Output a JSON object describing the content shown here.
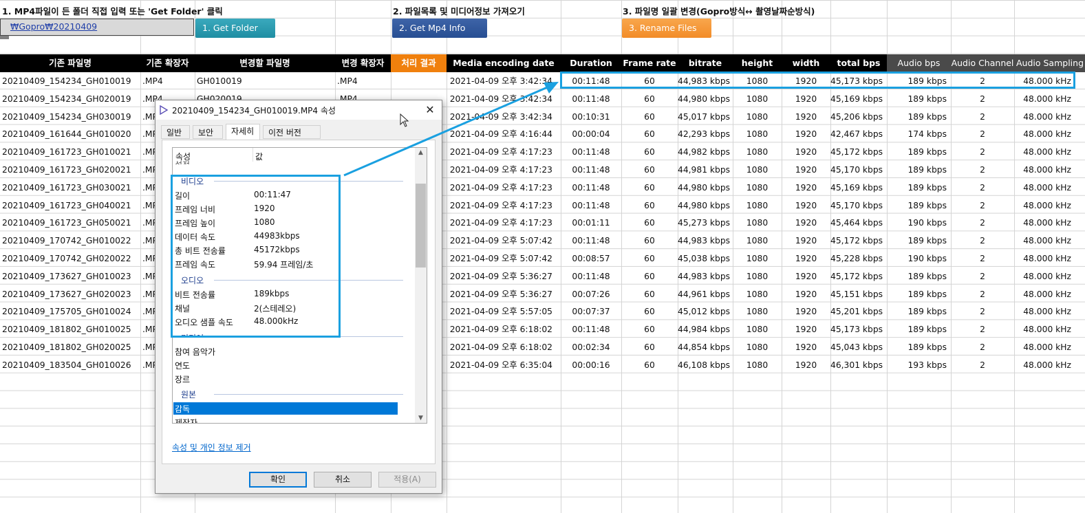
{
  "steps": {
    "step1": "1. MP4파일이 든 폴더 직접 입력 또는 'Get Folder' 클릭",
    "step2": "2. 파일목록 및 미디어정보 가져오기",
    "step3": "3. 파일명 일괄 변경(Gopro방식↔ 촬영날짜순방식)"
  },
  "folder_path": "₩Gopro₩20210409",
  "buttons": {
    "get_folder": "1. Get Folder",
    "get_mp4_info": "2. Get Mp4 Info",
    "rename_files": "3. Rename Files"
  },
  "headers": [
    "기존 파일명",
    "기존 확장자",
    "변경할 파일명",
    "변경 확장자",
    "처리 결과",
    "Media encoding date",
    "Duration",
    "Frame rate",
    "bitrate",
    "height",
    "width",
    "total bps",
    "Audio bps",
    "Audio Channel",
    "Audio Sampling"
  ],
  "rows": [
    [
      "20210409_154234_GH010019",
      ".MP4",
      "GH010019",
      ".MP4",
      "",
      "2021-04-09 오후 3:42:34",
      "00:11:48",
      "60",
      "44,983 kbps",
      "1080",
      "1920",
      "45,173 kbps",
      "189 kbps",
      "2",
      "48.000 kHz"
    ],
    [
      "20210409_154234_GH020019",
      ".MP4",
      "GH020019",
      ".MP4",
      "",
      "2021-04-09 오후 3:42:34",
      "00:11:48",
      "60",
      "44,980 kbps",
      "1080",
      "1920",
      "45,169 kbps",
      "189 kbps",
      "2",
      "48.000 kHz"
    ],
    [
      "20210409_154234_GH030019",
      ".MP4",
      "",
      "",
      "",
      "2021-04-09 오후 3:42:34",
      "00:10:31",
      "60",
      "45,017 kbps",
      "1080",
      "1920",
      "45,206 kbps",
      "189 kbps",
      "2",
      "48.000 kHz"
    ],
    [
      "20210409_161644_GH010020",
      ".MP4",
      "",
      "",
      "",
      "2021-04-09 오후 4:16:44",
      "00:00:04",
      "60",
      "42,293 kbps",
      "1080",
      "1920",
      "42,467 kbps",
      "174 kbps",
      "2",
      "48.000 kHz"
    ],
    [
      "20210409_161723_GH010021",
      ".MP4",
      "",
      "",
      "",
      "2021-04-09 오후 4:17:23",
      "00:11:48",
      "60",
      "44,982 kbps",
      "1080",
      "1920",
      "45,172 kbps",
      "189 kbps",
      "2",
      "48.000 kHz"
    ],
    [
      "20210409_161723_GH020021",
      ".MP4",
      "",
      "",
      "",
      "2021-04-09 오후 4:17:23",
      "00:11:48",
      "60",
      "44,981 kbps",
      "1080",
      "1920",
      "45,170 kbps",
      "189 kbps",
      "2",
      "48.000 kHz"
    ],
    [
      "20210409_161723_GH030021",
      ".MP4",
      "",
      "",
      "",
      "2021-04-09 오후 4:17:23",
      "00:11:48",
      "60",
      "44,980 kbps",
      "1080",
      "1920",
      "45,169 kbps",
      "189 kbps",
      "2",
      "48.000 kHz"
    ],
    [
      "20210409_161723_GH040021",
      ".MP4",
      "",
      "",
      "",
      "2021-04-09 오후 4:17:23",
      "00:11:48",
      "60",
      "44,980 kbps",
      "1080",
      "1920",
      "45,170 kbps",
      "189 kbps",
      "2",
      "48.000 kHz"
    ],
    [
      "20210409_161723_GH050021",
      ".MP4",
      "",
      "",
      "",
      "2021-04-09 오후 4:17:23",
      "00:01:11",
      "60",
      "45,273 kbps",
      "1080",
      "1920",
      "45,464 kbps",
      "190 kbps",
      "2",
      "48.000 kHz"
    ],
    [
      "20210409_170742_GH010022",
      ".MP4",
      "",
      "",
      "",
      "2021-04-09 오후 5:07:42",
      "00:11:48",
      "60",
      "44,983 kbps",
      "1080",
      "1920",
      "45,172 kbps",
      "189 kbps",
      "2",
      "48.000 kHz"
    ],
    [
      "20210409_170742_GH020022",
      ".MP4",
      "",
      "",
      "",
      "2021-04-09 오후 5:07:42",
      "00:08:57",
      "60",
      "45,038 kbps",
      "1080",
      "1920",
      "45,228 kbps",
      "190 kbps",
      "2",
      "48.000 kHz"
    ],
    [
      "20210409_173627_GH010023",
      ".MP4",
      "",
      "",
      "",
      "2021-04-09 오후 5:36:27",
      "00:11:48",
      "60",
      "44,983 kbps",
      "1080",
      "1920",
      "45,172 kbps",
      "189 kbps",
      "2",
      "48.000 kHz"
    ],
    [
      "20210409_173627_GH020023",
      ".MP4",
      "",
      "",
      "",
      "2021-04-09 오후 5:36:27",
      "00:07:26",
      "60",
      "44,961 kbps",
      "1080",
      "1920",
      "45,151 kbps",
      "189 kbps",
      "2",
      "48.000 kHz"
    ],
    [
      "20210409_175705_GH010024",
      ".MP4",
      "",
      "",
      "",
      "2021-04-09 오후 5:57:05",
      "00:07:37",
      "60",
      "45,012 kbps",
      "1080",
      "1920",
      "45,201 kbps",
      "189 kbps",
      "2",
      "48.000 kHz"
    ],
    [
      "20210409_181802_GH010025",
      ".MP4",
      "",
      "",
      "",
      "2021-04-09 오후 6:18:02",
      "00:11:48",
      "60",
      "44,984 kbps",
      "1080",
      "1920",
      "45,173 kbps",
      "189 kbps",
      "2",
      "48.000 kHz"
    ],
    [
      "20210409_181802_GH020025",
      ".MP4",
      "",
      "",
      "",
      "2021-04-09 오후 6:18:02",
      "00:02:34",
      "60",
      "44,854 kbps",
      "1080",
      "1920",
      "45,043 kbps",
      "189 kbps",
      "2",
      "48.000 kHz"
    ],
    [
      "20210409_183504_GH010026",
      ".MP4",
      "",
      "",
      "",
      "2021-04-09 오후 6:35:04",
      "00:00:16",
      "60",
      "46,108 kbps",
      "1080",
      "1920",
      "46,301 kbps",
      "193 kbps",
      "2",
      "48.000 kHz"
    ]
  ],
  "dialog": {
    "title": "20210409_154234_GH010019.MP4 속성",
    "tabs": [
      "일반",
      "보안",
      "자세히",
      "이전 버전"
    ],
    "list_header": {
      "prop": "속성",
      "value": "값"
    },
    "partial_top": "설정",
    "video_section": "비디오",
    "video_props": [
      {
        "name": "길이",
        "value": "00:11:47"
      },
      {
        "name": "프레임 너비",
        "value": "1920"
      },
      {
        "name": "프레임 높이",
        "value": "1080"
      },
      {
        "name": "데이터 속도",
        "value": "44983kbps"
      },
      {
        "name": "총 비트 전송률",
        "value": "45172kbps"
      },
      {
        "name": "프레임 속도",
        "value": "59.94 프레임/초"
      }
    ],
    "audio_section": "오디오",
    "audio_props": [
      {
        "name": "비트 전송률",
        "value": "189kbps"
      },
      {
        "name": "채널",
        "value": "2(스테레오)"
      },
      {
        "name": "오디오 샘플 속도",
        "value": "48.000kHz"
      }
    ],
    "media_section": "미디어",
    "media_props": [
      "참여 음악가",
      "연도",
      "장르"
    ],
    "origin_section": "원본",
    "origin_props": [
      "감독",
      "제작자"
    ],
    "remove_link": "속성 및 개인 정보 제거",
    "ok": "확인",
    "cancel": "취소",
    "apply": "적용(A)"
  },
  "colors": {
    "highlight": "#1aa0e0",
    "header_bg": "#000000",
    "result_header": "#f0800d"
  }
}
